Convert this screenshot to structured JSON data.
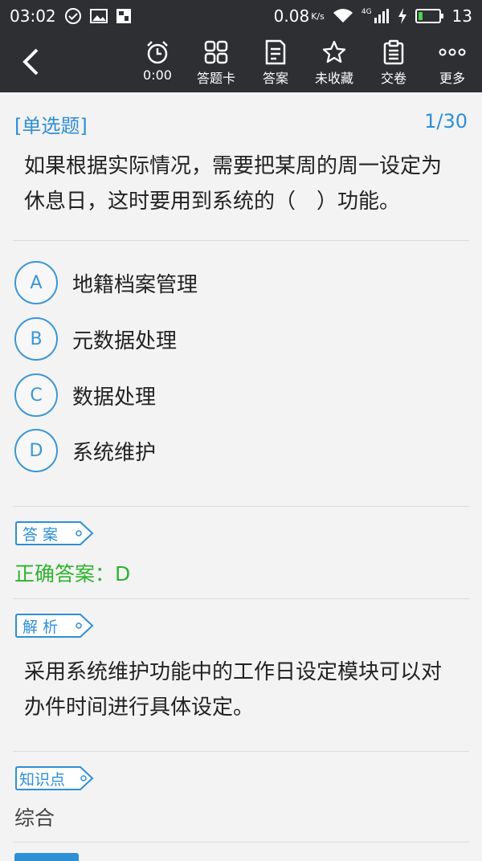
{
  "status_bar": {
    "time": "03:02",
    "speed": "0.08",
    "speed_unit": "K/s",
    "network": "4G",
    "battery": "13"
  },
  "toolbar": {
    "timer": "0:00",
    "answer_card": "答题卡",
    "answer": "答案",
    "favorite": "未收藏",
    "submit": "交卷",
    "more": "更多"
  },
  "question": {
    "type": "[单选题]",
    "progress": "1/30",
    "text": "如果根据实际情况，需要把某周的周一设定为休息日，这时要用到系统的（　）功能。"
  },
  "options": [
    {
      "key": "A",
      "text": "地籍档案管理"
    },
    {
      "key": "B",
      "text": "元数据处理"
    },
    {
      "key": "C",
      "text": "数据处理"
    },
    {
      "key": "D",
      "text": "系统维护"
    }
  ],
  "answer_section": {
    "tag": "答案",
    "text": "正确答案：D"
  },
  "analysis_section": {
    "tag": "解析",
    "text": "采用系统维护功能中的工作日设定模块可以对办件时间进行具体设定。"
  },
  "knowledge_section": {
    "tag": "知识点",
    "text": "综合"
  },
  "colors": {
    "accent": "#2e8fd6",
    "correct": "#2db32d",
    "bar": "#2d2f33"
  }
}
